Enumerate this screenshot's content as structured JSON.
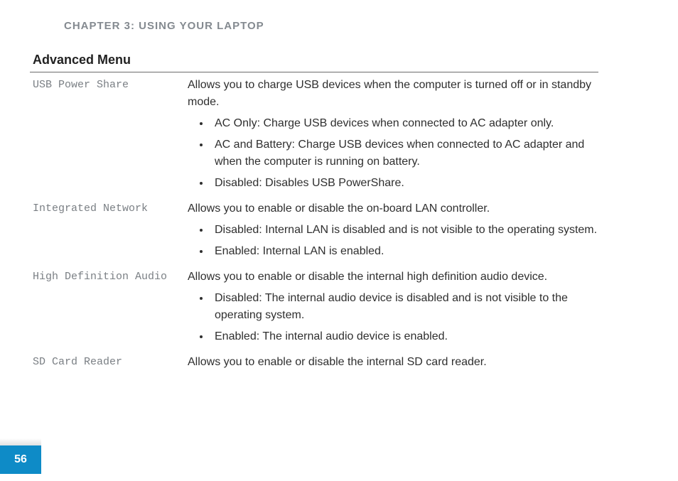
{
  "chapter_header": "CHAPTER 3: USING YOUR LAPTOP",
  "section_title": "Advanced Menu",
  "page_number": "56",
  "settings": [
    {
      "name": "USB Power Share",
      "intro": "Allows you to charge USB devices when the computer is turned off or in standby mode.",
      "bullets": [
        "AC Only: Charge USB devices when connected to AC adapter only.",
        "AC and Battery: Charge USB devices when connected to AC adapter and when the computer is running on battery.",
        "Disabled: Disables USB PowerShare."
      ]
    },
    {
      "name": "Integrated Network",
      "intro": "Allows you to enable or disable the on-board LAN controller.",
      "bullets": [
        "Disabled: Internal LAN is disabled and is not visible to the operating system.",
        "Enabled: Internal LAN is enabled."
      ]
    },
    {
      "name": "High Definition Audio",
      "intro": "Allows you to enable or disable the internal high definition audio device.",
      "bullets": [
        "Disabled: The internal audio device is disabled and is not visible to the operating system.",
        "Enabled: The internal audio device is enabled."
      ]
    },
    {
      "name": "SD Card Reader",
      "intro": "Allows you to enable or disable the internal SD card reader.",
      "bullets": []
    }
  ]
}
